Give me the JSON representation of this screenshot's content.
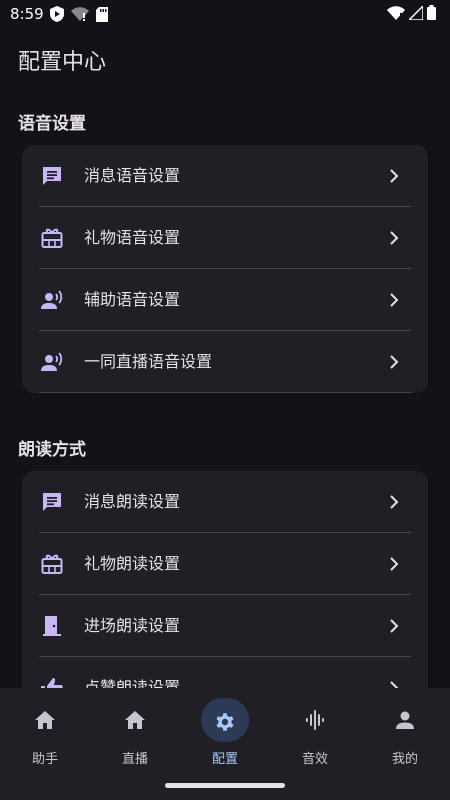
{
  "status": {
    "time": "8:59"
  },
  "page_title": "配置中心",
  "sections": [
    {
      "title": "语音设置",
      "items": [
        {
          "label": "消息语音设置",
          "icon": "message-icon"
        },
        {
          "label": "礼物语音设置",
          "icon": "gift-icon"
        },
        {
          "label": "辅助语音设置",
          "icon": "voice-user-icon"
        },
        {
          "label": "一同直播语音设置",
          "icon": "voice-user-icon"
        }
      ]
    },
    {
      "title": "朗读方式",
      "items": [
        {
          "label": "消息朗读设置",
          "icon": "message-icon"
        },
        {
          "label": "礼物朗读设置",
          "icon": "gift-icon"
        },
        {
          "label": "进场朗读设置",
          "icon": "door-icon"
        },
        {
          "label": "点赞朗读设置",
          "icon": "thumb-up-icon"
        }
      ]
    }
  ],
  "nav": [
    {
      "label": "助手",
      "icon": "home-icon"
    },
    {
      "label": "直播",
      "icon": "home-icon"
    },
    {
      "label": "配置",
      "icon": "gear-icon",
      "active": true
    },
    {
      "label": "音效",
      "icon": "waveform-icon"
    },
    {
      "label": "我的",
      "icon": "person-icon"
    }
  ],
  "colors": {
    "accent": "#c9b7f5",
    "nav_active": "#a8c7fa",
    "background": "#141218",
    "card": "#211f26"
  }
}
